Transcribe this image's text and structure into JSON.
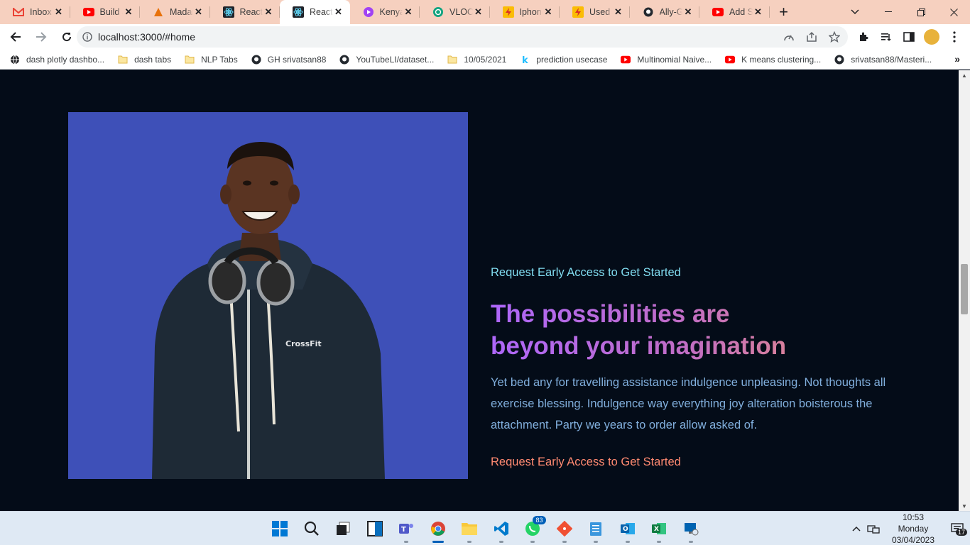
{
  "browser": {
    "tabs": [
      {
        "title": "Inbox (",
        "icon": "gmail-icon",
        "color": "#ea4335"
      },
      {
        "title": "Build a",
        "icon": "youtube-icon",
        "color": "#ff0000"
      },
      {
        "title": "Madan",
        "icon": "madan-icon",
        "color": "#e8710a"
      },
      {
        "title": "React A",
        "icon": "react-icon",
        "color": "#61dafb"
      },
      {
        "title": "React A",
        "icon": "react-icon",
        "color": "#61dafb",
        "active": true
      },
      {
        "title": "Kenya",
        "icon": "video-icon",
        "color": "#a142f4"
      },
      {
        "title": "VLOOK",
        "icon": "openai-icon",
        "color": "#10a37f"
      },
      {
        "title": "Iphone",
        "icon": "zap-icon",
        "color": "#fbbc04"
      },
      {
        "title": "Used P",
        "icon": "zap-icon",
        "color": "#fbbc04"
      },
      {
        "title": "Ally-Gl",
        "icon": "github-icon",
        "color": "#24292f"
      },
      {
        "title": "Add Sc",
        "icon": "youtube-icon",
        "color": "#ff0000"
      }
    ],
    "close_glyph": "✕",
    "new_tab_glyph": "+",
    "url": "localhost:3000/#home",
    "bookmarks": [
      {
        "label": "dash plotly dashbo...",
        "icon": "globe-icon"
      },
      {
        "label": "dash tabs",
        "icon": "folder-icon"
      },
      {
        "label": "NLP Tabs",
        "icon": "folder-icon"
      },
      {
        "label": "GH srivatsan88",
        "icon": "github-icon"
      },
      {
        "label": "YouTubeLI/dataset...",
        "icon": "github-icon"
      },
      {
        "label": "10/05/2021",
        "icon": "folder-icon"
      },
      {
        "label": "prediction usecase",
        "icon": "k-icon"
      },
      {
        "label": "Multinomial Naive...",
        "icon": "youtube-icon"
      },
      {
        "label": "K means clustering...",
        "icon": "youtube-icon"
      },
      {
        "label": "srivatsan88/Masteri...",
        "icon": "github-icon"
      }
    ],
    "bookmarks_more": "»"
  },
  "page": {
    "eyebrow": "Request Early Access to Get Started",
    "headline_line1": "The possibilities are",
    "headline_line2": "beyond your imagination",
    "body": "Yet bed any for travelling assistance indulgence unpleasing. Not thoughts all exercise blessing. Indulgence way everything joy alteration boisterous the attachment. Party we years to order allow asked of.",
    "cta": "Request Early Access to Get Started",
    "photo_alt_shirt_text": "CrossFit"
  },
  "colors": {
    "page_bg": "#040c18",
    "eyebrow": "#81dcf0",
    "headline_start": "#ae67fa",
    "headline_end": "#f49867",
    "body_text": "#81afdd",
    "cta": "#ff8a71",
    "photo_bg": "#3e50b8"
  },
  "taskbar": {
    "apps": [
      {
        "name": "start",
        "icon": "windows-icon"
      },
      {
        "name": "search",
        "icon": "search-icon"
      },
      {
        "name": "task-view",
        "icon": "task-view-icon"
      },
      {
        "name": "widgets",
        "icon": "widgets-icon"
      },
      {
        "name": "teams",
        "icon": "teams-icon"
      },
      {
        "name": "chrome",
        "icon": "chrome-icon",
        "active": true
      },
      {
        "name": "file-explorer",
        "icon": "folder-icon"
      },
      {
        "name": "vscode",
        "icon": "vscode-icon"
      },
      {
        "name": "whatsapp",
        "icon": "whatsapp-icon",
        "badge": "83"
      },
      {
        "name": "git",
        "icon": "git-icon"
      },
      {
        "name": "notepad",
        "icon": "notepad-icon"
      },
      {
        "name": "outlook",
        "icon": "outlook-icon"
      },
      {
        "name": "excel",
        "icon": "excel-icon"
      },
      {
        "name": "remote-desktop",
        "icon": "remote-desktop-icon"
      }
    ],
    "time": "10:53",
    "day": "Monday",
    "date": "03/04/2023",
    "notification_count": "17"
  }
}
